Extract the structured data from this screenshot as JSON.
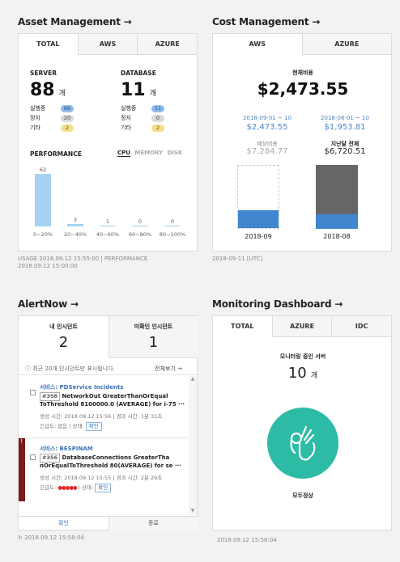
{
  "asset": {
    "title": "Asset Management →",
    "tabs": [
      "TOTAL",
      "AWS",
      "AZURE"
    ],
    "server": {
      "label": "SERVER",
      "count": "88",
      "unit": "개",
      "rows": [
        {
          "k": "실행중",
          "v": "66",
          "style": "blue"
        },
        {
          "k": "정지",
          "v": "20",
          "style": "gray"
        },
        {
          "k": "기타",
          "v": "2",
          "style": "yellow"
        }
      ]
    },
    "database": {
      "label": "DATABASE",
      "count": "11",
      "unit": "개",
      "rows": [
        {
          "k": "실행중",
          "v": "11",
          "style": "blue"
        },
        {
          "k": "정지",
          "v": "0",
          "style": "gray"
        },
        {
          "k": "기타",
          "v": "2",
          "style": "yellow"
        }
      ]
    },
    "performance": {
      "label": "PERFORMANCE",
      "metrics": [
        "CPU",
        "MEMORY",
        "DISK"
      ],
      "active_metric": "CPU"
    },
    "footer": [
      "USAGE 2018.09.12 15:55:00 | PERFORMANCE",
      "2018.09.12 15:00:00"
    ]
  },
  "chart_data": {
    "type": "bar",
    "categories": [
      "0~20%",
      "20~40%",
      "40~60%",
      "60~80%",
      "80~100%"
    ],
    "values": [
      62,
      3,
      1,
      0,
      0
    ],
    "ylim": [
      0,
      62
    ]
  },
  "cost": {
    "title": "Cost Management →",
    "tabs": [
      "AWS",
      "AZURE"
    ],
    "current_label": "현재비용",
    "current_value": "$2,473.55",
    "left": {
      "range": "2018-09-01 ~ 10",
      "value": "$2,473.55",
      "sub_label": "예상비용",
      "sub_value": "$7,284.77",
      "month": "2018-09",
      "fill_fraction": 0.28
    },
    "right": {
      "range": "2018-08-01 ~ 10",
      "value": "$1,953.81",
      "sub_label": "지난달 전체",
      "sub_value": "$6,720.51",
      "month": "2018-08",
      "fill_fraction": 0.23
    },
    "footer": "2018-09-11 [UTC]",
    "colors": {
      "blue": "#3f86cf",
      "gray": "#666666"
    }
  },
  "alert": {
    "title": "AlertNow →",
    "my_label": "내 인시던트",
    "my_count": "2",
    "unack_label": "미확인 인시던트",
    "unack_count": "1",
    "notice": "최근 20개 인시던트만 표시됩니다.",
    "view_all": "전체보기 →",
    "items": [
      {
        "service": "서비스: PDService Incidents",
        "id": "#358",
        "text1": "NetworkOut GreaterThanOrEqual",
        "text2": "ToThreshold 8100000.0 (AVERAGE) for i-75 ···",
        "meta": "생성 시간: 2018.09.12 15:56 | 경과 시간: 1분 31초",
        "urgency": "긴급도: 없음 | 상태:",
        "status": "확인",
        "stars": ""
      },
      {
        "service": "서비스: BESPINAM",
        "id": "#356",
        "text1": "DatabaseConnections GreaterTha",
        "text2": "nOrEqualToThreshold 80(AVERAGE) for se ···",
        "meta": "생성 시간: 2018.09.12 15:55 | 경과 시간: 2분 29초",
        "urgency": "긴급도:",
        "status": "확인",
        "stars": "●●●●●",
        "status_sep": "| 상태:"
      }
    ],
    "btn_confirm": "확인",
    "btn_close": "종료",
    "footer": "2018.09.12 15:58:04"
  },
  "monitor": {
    "title": "Monitoring Dashboard →",
    "tabs": [
      "TOTAL",
      "AZURE",
      "IDC"
    ],
    "label": "모니터링 중인 서버",
    "count": "10",
    "unit": "개",
    "status": "모두정상",
    "footer": "2018.09.12 15:58:04"
  }
}
